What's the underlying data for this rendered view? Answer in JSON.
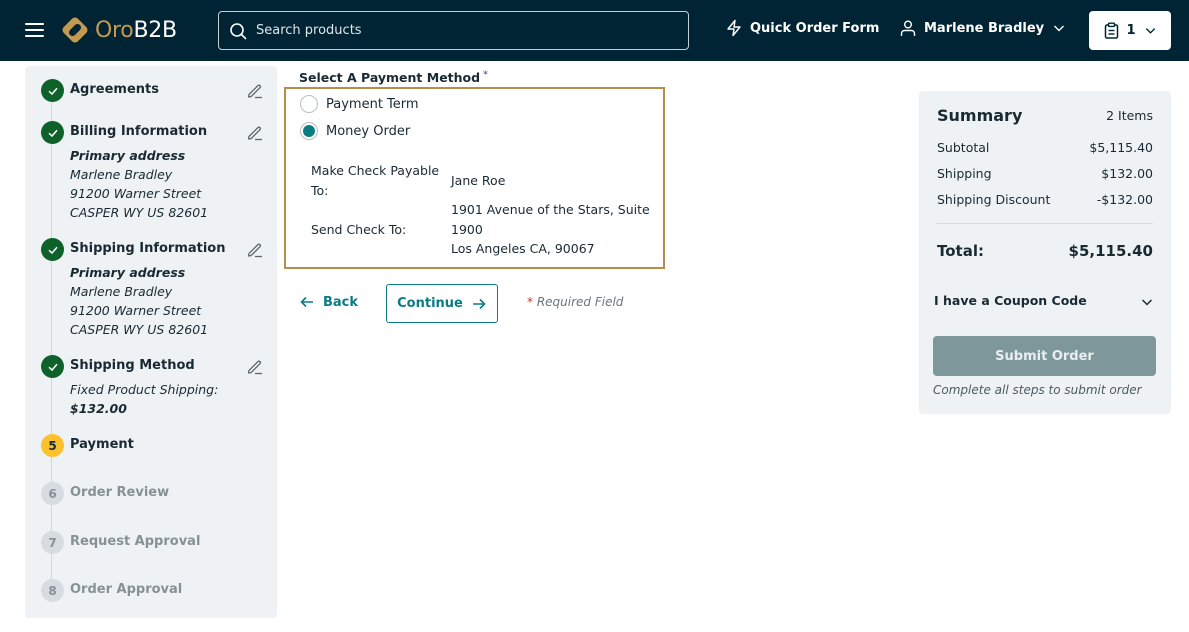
{
  "header": {
    "brand_part1": "Oro",
    "brand_part2": "B2B",
    "search_placeholder": "Search products",
    "quick_order_label": "Quick Order Form",
    "user_name": "Marlene Bradley",
    "cart_count": "1",
    "icons": {
      "menu": "hamburger-icon",
      "search": "search-icon",
      "quick_order": "lightning-icon",
      "user": "user-icon",
      "cart": "clipboard-icon",
      "dropdown": "chevron-down-icon"
    }
  },
  "checkout_steps": [
    {
      "number": "1",
      "title": "Agreements",
      "status": "completed",
      "details": [],
      "editable": true
    },
    {
      "number": "2",
      "title": "Billing Information",
      "status": "completed",
      "editable": true,
      "details": [
        "Primary address",
        "Marlene Bradley",
        "91200 Warner Street",
        "CASPER WY US 82601"
      ]
    },
    {
      "number": "3",
      "title": "Shipping Information",
      "status": "completed",
      "editable": true,
      "details": [
        "Primary address",
        "Marlene Bradley",
        "91200 Warner Street",
        "CASPER WY US 82601"
      ]
    },
    {
      "number": "4",
      "title": "Shipping Method",
      "status": "completed",
      "editable": true,
      "details": [
        "Fixed Product Shipping:",
        "$132.00"
      ]
    },
    {
      "number": "5",
      "title": "Payment",
      "status": "active"
    },
    {
      "number": "6",
      "title": "Order Review",
      "status": "pending"
    },
    {
      "number": "7",
      "title": "Request Approval",
      "status": "pending"
    },
    {
      "number": "8",
      "title": "Order Approval",
      "status": "pending"
    }
  ],
  "payment": {
    "label": "Select A Payment Method",
    "required_mark": "*",
    "options": [
      {
        "label": "Payment Term",
        "selected": false
      },
      {
        "label": "Money Order",
        "selected": true
      }
    ],
    "money_order": {
      "payable_label_line1": "Make Check Payable",
      "payable_label_line2": "To:",
      "payable_value": "Jane Roe",
      "send_label": "Send Check To:",
      "send_value_line1": "1901 Avenue of the Stars, Suite",
      "send_value_line2": "1900",
      "send_value_line3": "Los Angeles CA, 90067"
    }
  },
  "actions": {
    "back_label": "Back",
    "continue_label": "Continue",
    "required_star": "*",
    "required_text": " Required Field"
  },
  "summary": {
    "title": "Summary",
    "items_count": "2 Items",
    "rows": [
      {
        "label": "Subtotal",
        "value": "$5,115.40"
      },
      {
        "label": "Shipping",
        "value": "$132.00"
      },
      {
        "label": "Shipping Discount",
        "value": "-$132.00"
      }
    ],
    "total_label": "Total:",
    "total_value": "$5,115.40",
    "coupon_label": "I have a Coupon Code",
    "submit_label": "Submit Order",
    "submit_note": "Complete all steps to submit order"
  },
  "colors": {
    "header_bg": "#002434",
    "brand_gold": "#c39a51",
    "accent_teal": "#0b7b84",
    "step_done": "#0d6129",
    "step_active": "#fcc12d",
    "panel_bg": "#eff2f5",
    "payment_box_border": "#b58d4c",
    "submit_disabled": "#7e979b"
  }
}
